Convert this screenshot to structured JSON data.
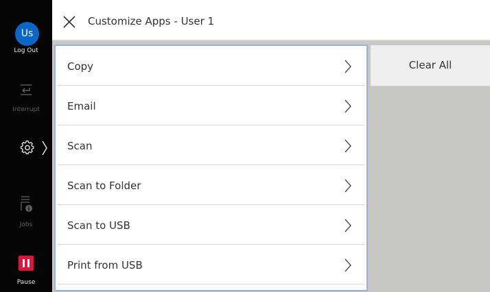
{
  "header": {
    "title": "Customize Apps - User 1",
    "close_icon": "close-icon"
  },
  "sidebar": {
    "avatar_initials": "Us",
    "avatar_color": "#0a66c7",
    "logout_label": "Log Out",
    "interrupt_label": "Interrupt",
    "jobs_label": "Jobs",
    "pause_label": "Pause",
    "pause_color": "#e5113d",
    "icons": [
      "interrupt-icon",
      "gear-icon",
      "chevron-right-icon",
      "jobs-icon",
      "pause-icon"
    ]
  },
  "apps": [
    {
      "label": "Copy"
    },
    {
      "label": "Email"
    },
    {
      "label": "Scan"
    },
    {
      "label": "Scan to Folder"
    },
    {
      "label": "Scan to USB"
    },
    {
      "label": "Print from USB"
    }
  ],
  "actions": {
    "clear_all_label": "Clear All"
  },
  "colors": {
    "selection_border": "#97b3db",
    "background_gray": "#c7c7c5"
  }
}
